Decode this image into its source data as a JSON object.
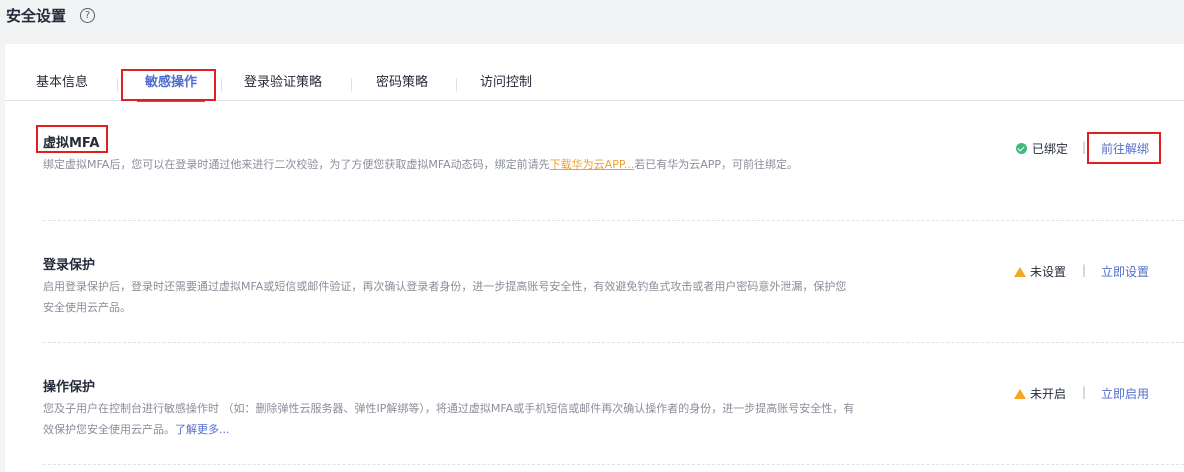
{
  "header": {
    "title": "安全设置",
    "help_icon": "?"
  },
  "tabs": [
    {
      "label": "基本信息"
    },
    {
      "label": "敏感操作"
    },
    {
      "label": "登录验证策略"
    },
    {
      "label": "密码策略"
    },
    {
      "label": "访问控制"
    }
  ],
  "mfa": {
    "title": "虚拟MFA",
    "desc_1": "绑定虚拟MFA后，您可以在登录时通过他来进行二次校验，为了方便您获取虚拟MFA动态码，绑定前请先",
    "desc_link": "下载华为云APP...",
    "desc_2": "若已有华为云APP，可前往绑定。",
    "status": "已绑定",
    "action": "前往解绑"
  },
  "login": {
    "title": "登录保护",
    "desc": "启用登录保护后，登录时还需要通过虚拟MFA或短信或邮件验证，再次确认登录者身份，进一步提高账号安全性，有效避免钓鱼式攻击或者用户密码意外泄漏，保护您安全使用云产品。",
    "status": "未设置",
    "action": "立即设置"
  },
  "operation": {
    "title": "操作保护",
    "desc": "您及子用户在控制台进行敏感操作时 （如：删除弹性云服务器、弹性IP解绑等），将通过虚拟MFA或手机短信或邮件再次确认操作者的身份，进一步提高账号安全性，有效保护您安全使用云产品。",
    "desc_link": "了解更多...",
    "status": "未开启",
    "action": "立即启用"
  },
  "separator": "|",
  "colors": {
    "accent": "#526ecc",
    "ok": "#3fba7a",
    "warn": "#f5a623",
    "highlight": "#e02020"
  }
}
